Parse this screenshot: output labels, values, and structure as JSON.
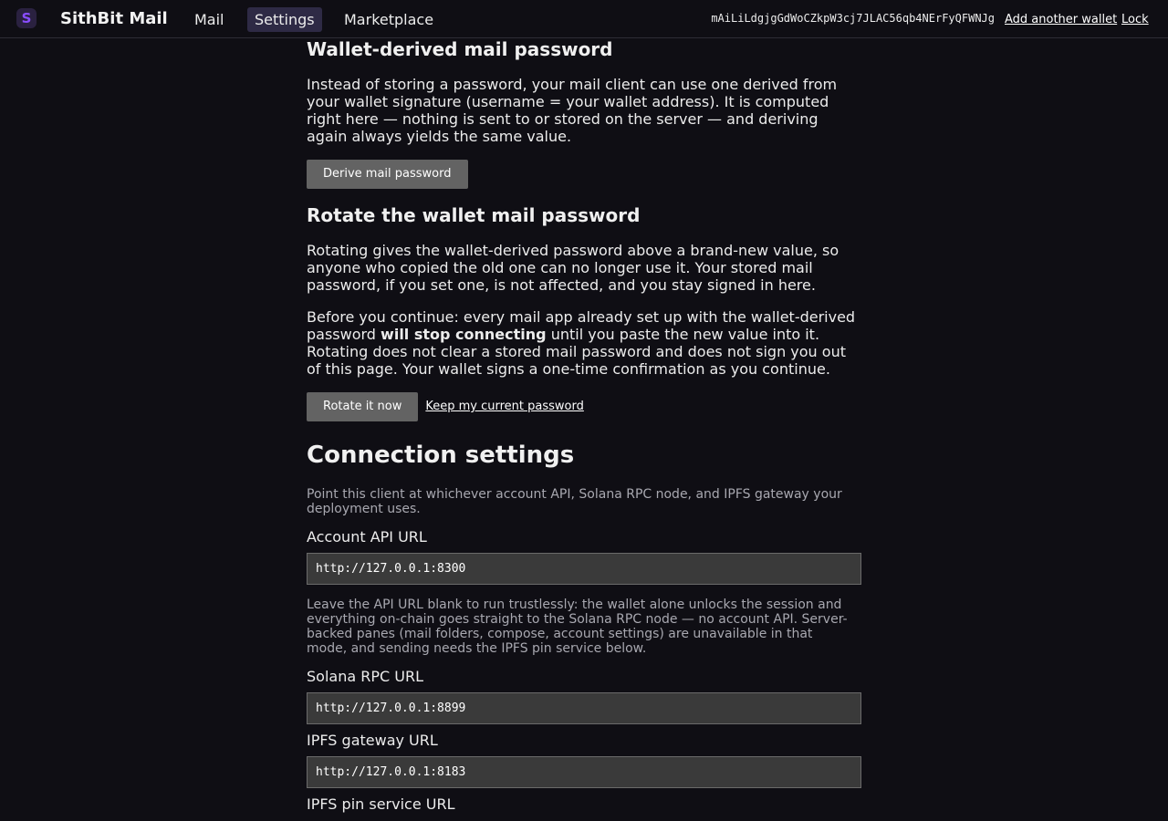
{
  "header": {
    "logo_glyph": "S",
    "app_title": "SithBit Mail",
    "nav": [
      {
        "label": "Mail"
      },
      {
        "label": "Settings",
        "active": true
      },
      {
        "label": "Marketplace"
      }
    ],
    "wallet_address": "mAiLiLdgjgGdWoCZkpW3cj7JLAC56qb4NErFyQFWNJg",
    "add_wallet_label": "Add another wallet",
    "lock_label": "Lock"
  },
  "derived": {
    "title": "Wallet-derived mail password",
    "description": "Instead of storing a password, your mail client can use one derived from your wallet signature (username = your wallet address). It is computed right here — nothing is sent to or stored on the server — and deriving again always yields the same value.",
    "button_label": "Derive mail password"
  },
  "rotate": {
    "title": "Rotate the wallet mail password",
    "description": "Rotating gives the wallet-derived password above a brand-new value, so anyone who copied the old one can no longer use it. Your stored mail password, if you set one, is not affected, and you stay signed in here.",
    "warning_pre": "Before you continue: every mail app already set up with the wallet-derived password ",
    "warning_bold": "will stop connecting",
    "warning_post": " until you paste the new value into it. Rotating does not clear a stored mail password and does not sign you out of this page. Your wallet signs a one-time confirmation as you continue.",
    "confirm_label": "Rotate it now",
    "cancel_label": "Keep my current password"
  },
  "connection": {
    "title": "Connection settings",
    "intro": "Point this client at whichever account API, Solana RPC node, and IPFS gateway your deployment uses.",
    "api_label": "Account API URL",
    "api_value": "http://127.0.0.1:8300",
    "api_help": "Leave the API URL blank to run trustlessly: the wallet alone unlocks the session and everything on-chain goes straight to the Solana RPC node — no account API. Server-backed panes (mail folders, compose, account settings) are unavailable in that mode, and sending needs the IPFS pin service below.",
    "rpc_label": "Solana RPC URL",
    "rpc_value": "http://127.0.0.1:8899",
    "ipfs_label": "IPFS gateway URL",
    "ipfs_value": "http://127.0.0.1:8183",
    "pin_label": "IPFS pin service URL"
  },
  "colors": {
    "background": "#0f0e14",
    "accent": "#8a4dff",
    "active_tab": "#2e2a45",
    "button": "#636363"
  }
}
